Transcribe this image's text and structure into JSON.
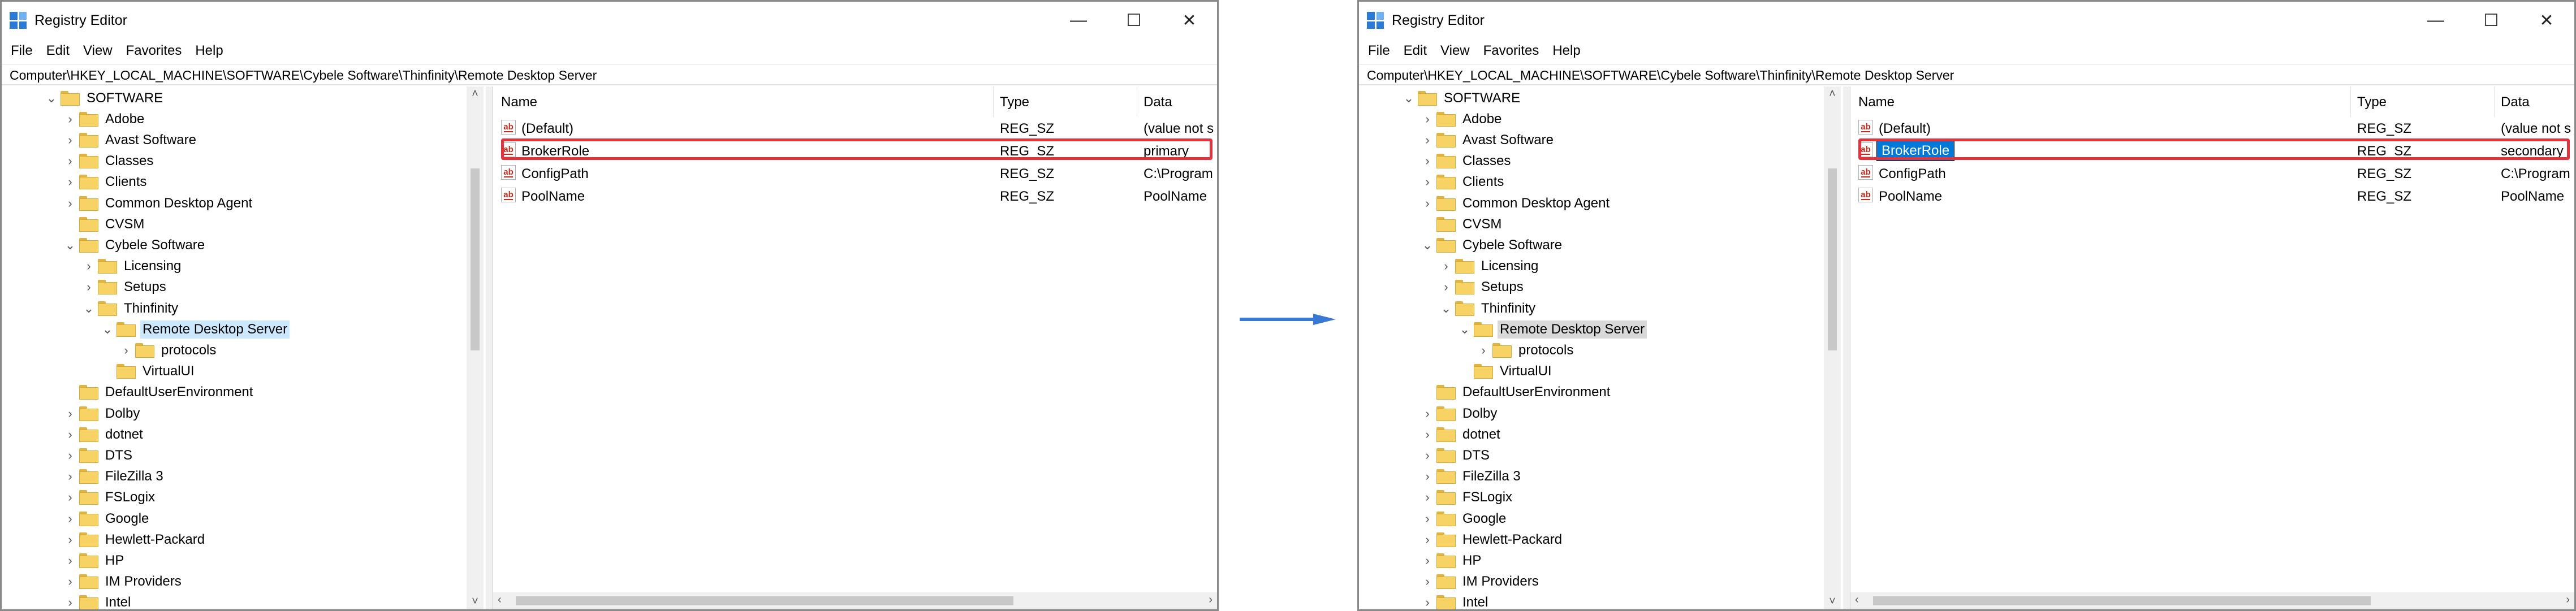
{
  "left": {
    "title": "Registry Editor",
    "caption": {
      "minimize": "—",
      "maximize": "☐",
      "close": "✕"
    },
    "menu": [
      "File",
      "Edit",
      "View",
      "Favorites",
      "Help"
    ],
    "address": "Computer\\HKEY_LOCAL_MACHINE\\SOFTWARE\\Cybele Software\\Thinfinity\\Remote Desktop Server",
    "tree": [
      {
        "label": "SOFTWARE",
        "level": 0,
        "expander": "⌄"
      },
      {
        "label": "Adobe",
        "level": 1,
        "expander": "›"
      },
      {
        "label": "Avast Software",
        "level": 1,
        "expander": "›"
      },
      {
        "label": "Classes",
        "level": 1,
        "expander": "›"
      },
      {
        "label": "Clients",
        "level": 1,
        "expander": "›"
      },
      {
        "label": "Common Desktop Agent",
        "level": 1,
        "expander": "›"
      },
      {
        "label": "CVSM",
        "level": 1,
        "expander": ""
      },
      {
        "label": "Cybele Software",
        "level": 1,
        "expander": "⌄"
      },
      {
        "label": "Licensing",
        "level": 2,
        "expander": "›"
      },
      {
        "label": "Setups",
        "level": 2,
        "expander": "›"
      },
      {
        "label": "Thinfinity",
        "level": 2,
        "expander": "⌄"
      },
      {
        "label": "Remote Desktop Server",
        "level": 3,
        "expander": "⌄",
        "selected": "active"
      },
      {
        "label": "protocols",
        "level": 4,
        "expander": "›"
      },
      {
        "label": "VirtualUI",
        "level": 3,
        "expander": ""
      },
      {
        "label": "DefaultUserEnvironment",
        "level": 1,
        "expander": ""
      },
      {
        "label": "Dolby",
        "level": 1,
        "expander": "›"
      },
      {
        "label": "dotnet",
        "level": 1,
        "expander": "›"
      },
      {
        "label": "DTS",
        "level": 1,
        "expander": "›"
      },
      {
        "label": "FileZilla 3",
        "level": 1,
        "expander": "›"
      },
      {
        "label": "FSLogix",
        "level": 1,
        "expander": "›"
      },
      {
        "label": "Google",
        "level": 1,
        "expander": "›"
      },
      {
        "label": "Hewlett-Packard",
        "level": 1,
        "expander": "›"
      },
      {
        "label": "HP",
        "level": 1,
        "expander": "›"
      },
      {
        "label": "IM Providers",
        "level": 1,
        "expander": "›"
      },
      {
        "label": "Intel",
        "level": 1,
        "expander": "›"
      }
    ],
    "columns": {
      "name": "Name",
      "type": "Type",
      "data": "Data"
    },
    "values": [
      {
        "name": "(Default)",
        "type": "REG_SZ",
        "data": "(value not s"
      },
      {
        "name": "BrokerRole",
        "type": "REG_SZ",
        "data": "primary"
      },
      {
        "name": "ConfigPath",
        "type": "REG_SZ",
        "data": "C:\\Program"
      },
      {
        "name": "PoolName",
        "type": "REG_SZ",
        "data": "PoolName"
      }
    ]
  },
  "right": {
    "title": "Registry Editor",
    "caption": {
      "minimize": "—",
      "maximize": "☐",
      "close": "✕"
    },
    "menu": [
      "File",
      "Edit",
      "View",
      "Favorites",
      "Help"
    ],
    "address": "Computer\\HKEY_LOCAL_MACHINE\\SOFTWARE\\Cybele Software\\Thinfinity\\Remote Desktop Server",
    "tree": [
      {
        "label": "SOFTWARE",
        "level": 0,
        "expander": "⌄"
      },
      {
        "label": "Adobe",
        "level": 1,
        "expander": "›"
      },
      {
        "label": "Avast Software",
        "level": 1,
        "expander": "›"
      },
      {
        "label": "Classes",
        "level": 1,
        "expander": "›"
      },
      {
        "label": "Clients",
        "level": 1,
        "expander": "›"
      },
      {
        "label": "Common Desktop Agent",
        "level": 1,
        "expander": "›"
      },
      {
        "label": "CVSM",
        "level": 1,
        "expander": ""
      },
      {
        "label": "Cybele Software",
        "level": 1,
        "expander": "⌄"
      },
      {
        "label": "Licensing",
        "level": 2,
        "expander": "›"
      },
      {
        "label": "Setups",
        "level": 2,
        "expander": "›"
      },
      {
        "label": "Thinfinity",
        "level": 2,
        "expander": "⌄"
      },
      {
        "label": "Remote Desktop Server",
        "level": 3,
        "expander": "⌄",
        "selected": "inactive"
      },
      {
        "label": "protocols",
        "level": 4,
        "expander": "›"
      },
      {
        "label": "VirtualUI",
        "level": 3,
        "expander": ""
      },
      {
        "label": "DefaultUserEnvironment",
        "level": 1,
        "expander": ""
      },
      {
        "label": "Dolby",
        "level": 1,
        "expander": "›"
      },
      {
        "label": "dotnet",
        "level": 1,
        "expander": "›"
      },
      {
        "label": "DTS",
        "level": 1,
        "expander": "›"
      },
      {
        "label": "FileZilla 3",
        "level": 1,
        "expander": "›"
      },
      {
        "label": "FSLogix",
        "level": 1,
        "expander": "›"
      },
      {
        "label": "Google",
        "level": 1,
        "expander": "›"
      },
      {
        "label": "Hewlett-Packard",
        "level": 1,
        "expander": "›"
      },
      {
        "label": "HP",
        "level": 1,
        "expander": "›"
      },
      {
        "label": "IM Providers",
        "level": 1,
        "expander": "›"
      },
      {
        "label": "Intel",
        "level": 1,
        "expander": "›"
      }
    ],
    "columns": {
      "name": "Name",
      "type": "Type",
      "data": "Data"
    },
    "values": [
      {
        "name": "(Default)",
        "type": "REG_SZ",
        "data": "(value not s"
      },
      {
        "name": "BrokerRole",
        "type": "REG_SZ",
        "data": "secondary",
        "editing": true
      },
      {
        "name": "ConfigPath",
        "type": "REG_SZ",
        "data": "C:\\Program"
      },
      {
        "name": "PoolName",
        "type": "REG_SZ",
        "data": "PoolName"
      }
    ]
  },
  "colors": {
    "accent": "#0078d7",
    "highlight": "#e2343c",
    "arrow": "#3a78d6",
    "folder": "#f7d366"
  }
}
